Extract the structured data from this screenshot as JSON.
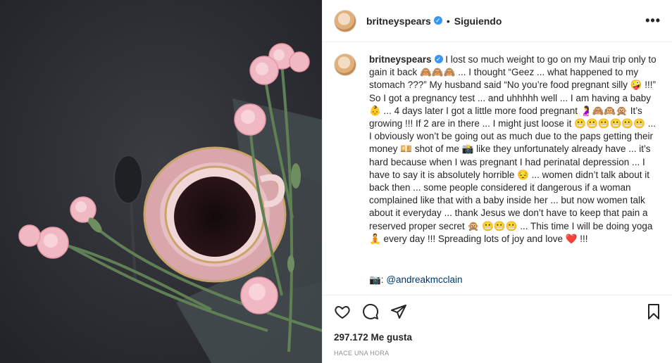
{
  "post": {
    "image_alt": "pink carnations with a teacup of coffee on a dark surface"
  },
  "header": {
    "username": "britneyspears",
    "verified_icon": "verified-badge-icon",
    "separator": "•",
    "follow_label": "Siguiendo",
    "more_icon": "more-options-icon",
    "more_label": "•••"
  },
  "caption": {
    "username": "britneyspears",
    "text": " I lost so much weight to go on my Maui trip only to gain it back 🙈🙈🙈 ... I thought “Geez ... what happened to my stomach ???” My husband said “No you’re food pregnant silly 🤪 !!!” So I got a pregnancy test ... and uhhhhh well ... I am having a baby 👶 ... 4 days later I got a little more food pregnant 🤰🙈🙉🙊 It’s growing !!! If 2 are in there ... I might just loose it 😬😬😬😬😬😬 ... I obviously won’t be going out as much due to the paps getting their money 💴 shot of me 📸 like they unfortunately already have ... it’s hard because when I was pregnant I had perinatal depression ... I have to say it is absolutely horrible 😔 ... women didn’t talk about it back then ... some people considered it dangerous if a woman complained like that with a baby inside her ... but now women talk about it everyday ... thank Jesus we don’t have to keep that pain a reserved proper secret 🙊 😬😬😬 ... This time I will be doing yoga 🧘 every day !!! Spreading lots of joy and love ❤️ !!!",
    "credit_prefix": "📷: ",
    "credit_handle": "@andreakmcclain"
  },
  "actions": {
    "like_icon": "heart-icon",
    "comment_icon": "comment-icon",
    "share_icon": "share-icon",
    "save_icon": "bookmark-icon"
  },
  "stats": {
    "likes": "297.172 Me gusta",
    "timestamp": "HACE UNA HORA"
  },
  "colors": {
    "link": "#00376b",
    "verified": "#3897f0",
    "muted": "#8e8e8e"
  }
}
